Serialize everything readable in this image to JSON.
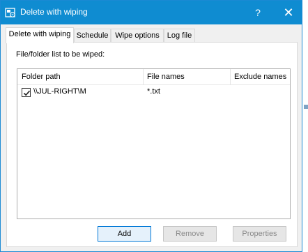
{
  "window": {
    "title": "Delete with wiping",
    "help_glyph": "?",
    "close_glyph": "✕",
    "accent_color": "#0f8cd1"
  },
  "tabs": [
    {
      "label": "Delete with wiping",
      "active": true
    },
    {
      "label": "Schedule",
      "active": false
    },
    {
      "label": "Wipe options",
      "active": false
    },
    {
      "label": "Log file",
      "active": false
    }
  ],
  "section": {
    "label": "File/folder list to be wiped:"
  },
  "list": {
    "columns": [
      "Folder path",
      "File names",
      "Exclude names"
    ],
    "rows": [
      {
        "checked": true,
        "folder_path": "\\\\JUL-RIGHT\\M",
        "file_names": "*.txt",
        "exclude_names": ""
      }
    ]
  },
  "buttons": {
    "add": "Add",
    "remove": "Remove",
    "properties": "Properties"
  },
  "icons": {
    "app": "app-icon",
    "checkbox": "checkmark-icon"
  }
}
